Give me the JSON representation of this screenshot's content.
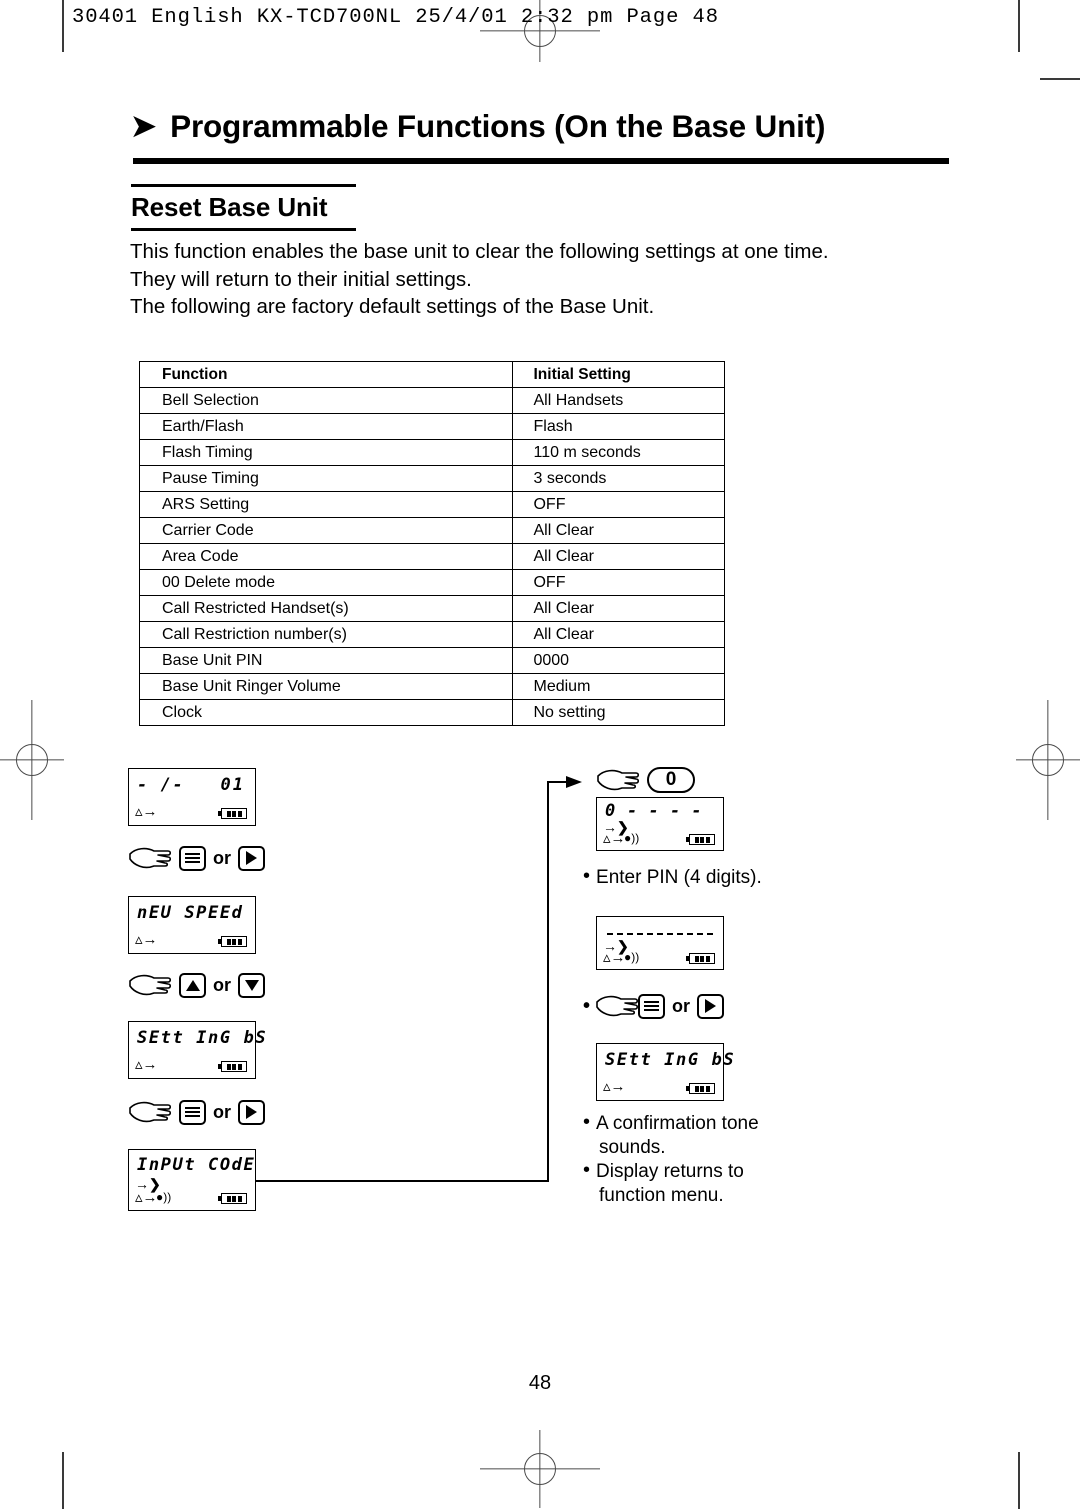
{
  "print_marks": {
    "imprint": "30401 English KX-TCD700NL  25/4/01  2:32 pm  Page 48"
  },
  "header": {
    "arrow_icon": "right-arrow-icon",
    "chapter_title": "Programmable Functions (On the Base Unit)",
    "section_title": "Reset Base Unit"
  },
  "intro": {
    "line1": "This function enables the base unit to clear the following settings at one time.",
    "line2": "They will return to their initial settings.",
    "line3": "The following are factory default settings of the Base Unit."
  },
  "table": {
    "headers": [
      "Function",
      "Initial Setting"
    ],
    "rows": [
      [
        "Bell Selection",
        "All Handsets"
      ],
      [
        "Earth/Flash",
        "Flash"
      ],
      [
        "Flash Timing",
        "110 m seconds"
      ],
      [
        "Pause Timing",
        "3 seconds"
      ],
      [
        "ARS Setting",
        "OFF"
      ],
      [
        "Carrier Code",
        "All Clear"
      ],
      [
        "Area Code",
        "All Clear"
      ],
      [
        "00 Delete mode",
        "OFF"
      ],
      [
        "Call Restricted Handset(s)",
        "All Clear"
      ],
      [
        "Call Restriction number(s)",
        "All Clear"
      ],
      [
        "Base Unit PIN",
        "0000"
      ],
      [
        "Base Unit Ringer Volume",
        "Medium"
      ],
      [
        "Clock",
        "No setting"
      ]
    ]
  },
  "flow": {
    "left": {
      "lcd1": {
        "text_left": "- /-",
        "text_right": "01"
      },
      "step1": {
        "or_label": "or",
        "key_a": "menu-key",
        "key_b": "right-arrow-key"
      },
      "lcd2": {
        "text_left": "nEU SPEEd"
      },
      "step2": {
        "or_label": "or",
        "key_a": "up-arrow-key",
        "key_b": "down-arrow-key"
      },
      "lcd3": {
        "text_left": "SEtt InG bS"
      },
      "step3": {
        "or_label": "or",
        "key_a": "menu-key",
        "key_b": "right-arrow-key"
      },
      "lcd4": {
        "text_left": "InPUt COdE"
      }
    },
    "right": {
      "step0": {
        "key_label": "0"
      },
      "lcd5": {
        "text_left": "0",
        "dashes": "- - - -"
      },
      "note1": "Enter PIN (4 digits).",
      "lcd6": {
        "dashes": "dashed-line"
      },
      "step4": {
        "or_label": "or",
        "key_a": "menu-key",
        "key_b": "right-arrow-key"
      },
      "lcd7": {
        "text_left": "SEtt InG bS"
      },
      "note2_line1": "A confirmation tone",
      "note2_line2": "sounds.",
      "note3_line1": "Display returns to",
      "note3_line2": "function menu."
    }
  },
  "footer": {
    "page_number": "48"
  },
  "colors": {
    "ink": "#000000",
    "paper": "#ffffff",
    "mark": "#4a4a4a"
  }
}
